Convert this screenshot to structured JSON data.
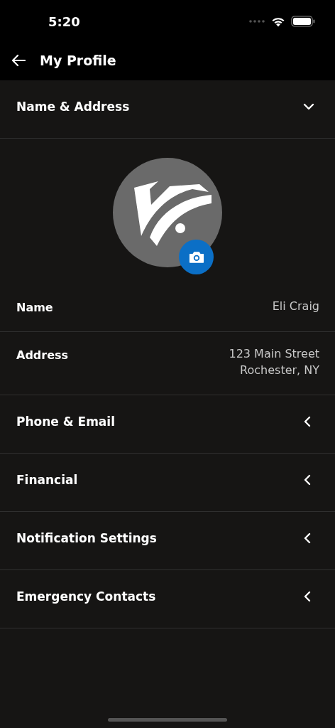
{
  "status_bar": {
    "time": "5:20"
  },
  "header": {
    "title": "My Profile"
  },
  "sections": [
    {
      "title": "Name & Address",
      "expanded": true,
      "fields": [
        {
          "label": "Name",
          "value_lines": [
            "Eli Craig"
          ]
        },
        {
          "label": "Address",
          "value_lines": [
            "123 Main Street",
            "Rochester, NY"
          ]
        }
      ]
    },
    {
      "title": "Phone & Email",
      "expanded": false
    },
    {
      "title": "Financial",
      "expanded": false
    },
    {
      "title": "Notification Settings",
      "expanded": false
    },
    {
      "title": "Emergency Contacts",
      "expanded": false
    }
  ]
}
